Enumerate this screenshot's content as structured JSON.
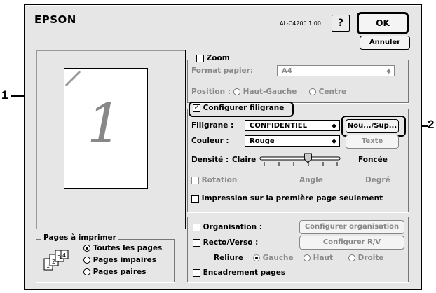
{
  "header": {
    "brand": "EPSON",
    "model": "AL-C4200 1.00",
    "help": "?",
    "ok": "OK",
    "cancel": "Annuler"
  },
  "preview": {
    "page_number": "1"
  },
  "zoom": {
    "label": "Zoom",
    "format_label": "Format papier:",
    "format_value": "A4",
    "position_label": "Position :",
    "pos_top_left": "Haut-Gauche",
    "pos_center": "Centre"
  },
  "watermark": {
    "enable_label": "Configurer filigrane",
    "filigrane_label": "Filigrane :",
    "filigrane_value": "CONFIDENTIEL",
    "new_button": "Nou.../Sup...",
    "couleur_label": "Couleur :",
    "couleur_value": "Rouge",
    "texte_button": "Texte",
    "densite_label": "Densité :",
    "claire": "Claire",
    "foncee": "Foncée",
    "density_level": 0.6,
    "rotation_label": "Rotation",
    "angle": "Angle",
    "degre": "Degré",
    "first_page_label": "Impression sur la première page seulement"
  },
  "layout": {
    "organisation_label": "Organisation :",
    "organisation_button": "Configurer organisation",
    "recto_label": "Recto/Verso :",
    "recto_button": "Configurer R/V",
    "reliure_label": "Reliure",
    "gauche": "Gauche",
    "haut": "Haut",
    "droite": "Droite",
    "frame_label": "Encadrement pages"
  },
  "pages": {
    "title": "Pages à imprimer",
    "all": "Toutes les pages",
    "odd": "Pages impaires",
    "even": "Pages paires"
  },
  "callouts": {
    "one": "1",
    "two": "2"
  }
}
